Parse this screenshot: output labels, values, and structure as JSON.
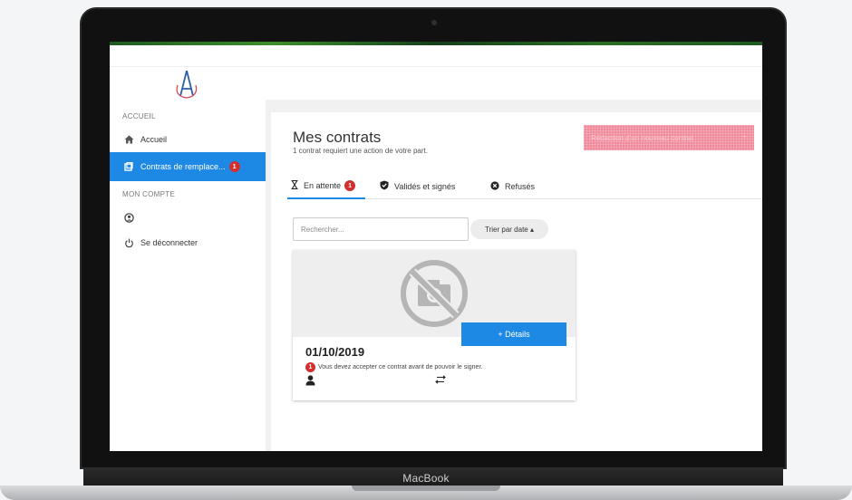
{
  "device": {
    "brand": "MacBook"
  },
  "sidebar": {
    "section1": "ACCUEIL",
    "item_home": "Accueil",
    "item_contracts": "Contrats de remplace...",
    "item_contracts_badge": "1",
    "section2": "MON COMPTE",
    "item_account": "",
    "item_logout": "Se déconnecter"
  },
  "header": {
    "title": "Mes contrats",
    "subtitle": "1 contrat requiert une action de votre part.",
    "new_button": "Rédaction d'un nouveau contrat",
    "new_button_icon": "+"
  },
  "tabs": [
    {
      "label": "En attente",
      "badge": "1",
      "icon": "hourglass-icon"
    },
    {
      "label": "Validés et signés",
      "icon": "shield-check-icon"
    },
    {
      "label": "Refusés",
      "icon": "x-circle-icon"
    }
  ],
  "filters": {
    "search_placeholder": "Rechercher...",
    "search_value": "",
    "sort_label": "Trier par date ▴"
  },
  "card": {
    "image_icon": "no-photo-icon",
    "details_button": "+ Détails",
    "date": "01/10/2019",
    "warning_badge": "1",
    "warning": "Vous devez accepter ce contrat avant de pouvoir le signer."
  },
  "colors": {
    "accent": "#1e88e5",
    "badge": "#d32f2f",
    "new_button": "#f08a9b"
  }
}
